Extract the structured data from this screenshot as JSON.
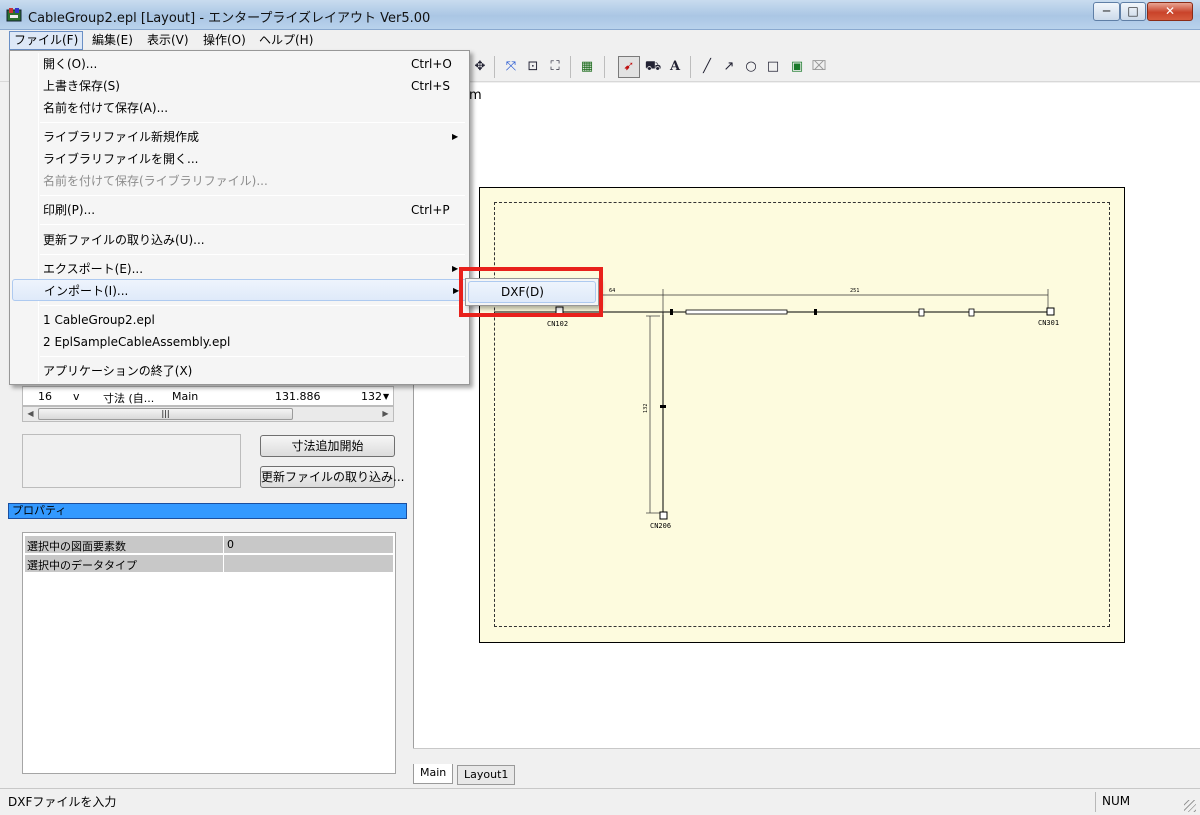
{
  "window": {
    "title": "CableGroup2.epl [Layout] - エンタープライズレイアウト Ver5.00",
    "minimize_label": "─",
    "maximize_label": "□",
    "close_label": "✕"
  },
  "menubar": [
    "ファイル(F)",
    "編集(E)",
    "表示(V)",
    "操作(O)",
    "ヘルプ(H)"
  ],
  "file_menu": [
    {
      "label": "開く(O)...",
      "accel": "Ctrl+O"
    },
    {
      "label": "上書き保存(S)",
      "accel": "Ctrl+S"
    },
    {
      "label": "名前を付けて保存(A)..."
    },
    {
      "label": "ライブラリファイル新規作成",
      "submenu": true
    },
    {
      "label": "ライブラリファイルを開く..."
    },
    {
      "label": "名前を付けて保存(ライブラリファイル)...",
      "disabled": true
    },
    {
      "label": "印刷(P)...",
      "accel": "Ctrl+P"
    },
    {
      "label": "更新ファイルの取り込み(U)..."
    },
    {
      "label": "エクスポート(E)...",
      "submenu": true
    },
    {
      "label": "インポート(I)...",
      "submenu": true,
      "highlighted": true
    },
    {
      "label": "1 CableGroup2.epl"
    },
    {
      "label": "2 EplSampleCableAssembly.epl"
    },
    {
      "label": "アプリケーションの終了(X)"
    }
  ],
  "submenu_import": {
    "label": "DXF(D)"
  },
  "canvas": {
    "scale_suffix": "m",
    "labels": {
      "cn102": "CN102",
      "cn301": "CN301",
      "cn206": "CN206",
      "dim_64": "64",
      "dim_251": "251",
      "dim_132": "132"
    }
  },
  "left_panel": {
    "row": {
      "no": "16",
      "flag": "v",
      "name": "寸法 (自...",
      "layer": "Main",
      "val1": "131.886",
      "val2": "132"
    },
    "hscroll_grip": "|||",
    "buttons": {
      "add_dimension": "寸法追加開始",
      "import_update": "更新ファイルの取り込み..."
    },
    "properties_title": "プロパティ",
    "properties": [
      {
        "key": "選択中の図面要素数",
        "value": "0"
      },
      {
        "key": "選択中のデータタイプ",
        "value": ""
      }
    ]
  },
  "tabs": [
    "Main",
    "Layout1"
  ],
  "status": {
    "message": "DXFファイルを入力",
    "num": "NUM"
  },
  "colors": {
    "paper": "#fdfbde",
    "properties_header": "#3399ff",
    "annotation_box": "#e8211c"
  },
  "icons": [
    "move-icon",
    "zoom-fit-icon",
    "zoom-window-icon",
    "zoom-select-icon",
    "table-icon",
    "select-pointer-icon",
    "bed-icon",
    "text-icon",
    "line-icon",
    "arrow-icon",
    "circle-icon",
    "rectangle-icon",
    "image-icon",
    "frame-icon"
  ]
}
